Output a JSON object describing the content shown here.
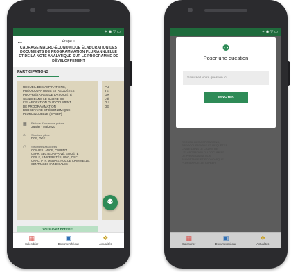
{
  "status_bar": {
    "icons": "✶ ◉ ▽ ▭"
  },
  "left_screen": {
    "back_icon": "←",
    "step": "Étape 1",
    "title": "CADRAGE MACRO-ÉCONOMIQUE ÉLABORATION DES DOCUMENTS DE PROGRAMMATION PLURIANNUELLE ET DE LA NOTE ANALYTIQUE SUR LE PROGRAMME DE DÉVELOPPEMENT",
    "section_title": "PARTICIPATIONS",
    "card": {
      "text": "RECUEIL DES ASPIRATIONS,\nPRÉOCCUPATIONS ET REQUÊTES\nPROPRIÉTAIRES DE LA SOCIÉTÉ\nCIVILE DANS LE CADRE DE\nL'ÉLABORATION DU DOCUMENT\nDE PROGRAMMATION\nBUDGÉTAIRE ET ÉCONOMIQUE\nPLURIANNUELLE (DPBEP)",
      "period_label": "Période d'ouverture prévue",
      "period_value": "Janvier - Mai 2020",
      "structure_label": "Structure pilote :",
      "structure_value": "DGB, DGE",
      "associated_label": "Structures associées",
      "associated_value": "CONAFIL, ANCB, CNPBNT,\nCSPR, SECTEUR PRIVÉ, SOCIÉTÉ\nCIVILE, UNIVERSITÉS, ONG, OSC,\nCNAC, PTF, MEDIAS, POLICE CRIMINELLE,\nCENTRALES SYNDICALES",
      "sent_text": "Vous avez notifié !"
    },
    "card2_text": "PU\nTE\nGR\nL'É\nDU\nDE",
    "fab_icon": "⚉"
  },
  "bottom_nav": {
    "items": [
      {
        "label": "Calendrier",
        "icon": "calendar-icon",
        "glyph": "▦"
      },
      {
        "label": "Documenthèque",
        "icon": "document-icon",
        "glyph": "▣"
      },
      {
        "label": "Actualités",
        "icon": "news-icon",
        "glyph": "❖"
      }
    ]
  },
  "right_screen": {
    "modal": {
      "icon_glyph": "⚉",
      "title": "Poser une question",
      "input_placeholder": "Saisissez votre question ici",
      "send_label": "ENVOYER"
    },
    "background_text": "RECUEIL DES ASPIRATIONS,\nPRÉOCCUPATIONS ET REQUÊTES\nCIVILE DANS LE CADRE DE\nL'ÉLABORATION DU DOCUMENT\nDE PROGRAMMATION\nBUDGÉTAIRE ET ÉCONOMIQUE\nPLURIANNUELLE (DPBEP)"
  },
  "colors": {
    "brand": "#2e8b57",
    "status_bar": "#1f6b3c",
    "card": "#ddd5bc"
  }
}
